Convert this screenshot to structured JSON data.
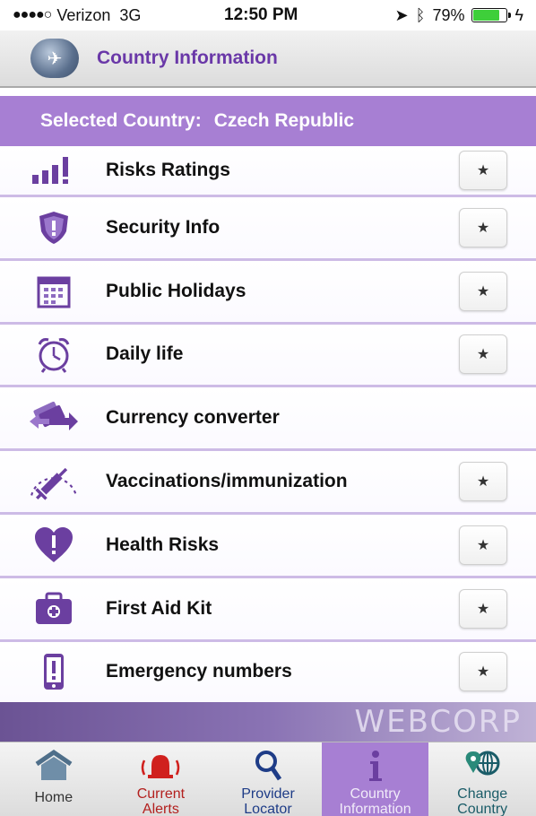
{
  "status": {
    "signal": "●●●●○",
    "carrier": "Verizon",
    "network": "3G",
    "time": "12:50 PM",
    "battery": "79%",
    "battery_level": 0.79
  },
  "header": {
    "title": "Country Information"
  },
  "selected": {
    "label": "Selected Country:",
    "country": "Czech Republic"
  },
  "items": [
    {
      "label": "Risks Ratings",
      "icon": "risk-rating-bars-icon",
      "favorite": true
    },
    {
      "label": "Security Info",
      "icon": "shield-alert-icon",
      "favorite": true
    },
    {
      "label": "Public Holidays",
      "icon": "calendar-icon",
      "favorite": true
    },
    {
      "label": "Daily life",
      "icon": "alarm-clock-icon",
      "favorite": true
    },
    {
      "label": "Currency converter",
      "icon": "currency-exchange-icon",
      "favorite": false
    },
    {
      "label": "Vaccinations/immunization",
      "icon": "syringe-icon",
      "favorite": true
    },
    {
      "label": "Health Risks",
      "icon": "heart-alert-icon",
      "favorite": true
    },
    {
      "label": "First Aid Kit",
      "icon": "first-aid-kit-icon",
      "favorite": true
    },
    {
      "label": "Emergency numbers",
      "icon": "phone-alert-icon",
      "favorite": true
    }
  ],
  "brand": "WEBCORP",
  "tabs": [
    {
      "label_line1": "Home",
      "label_line2": ""
    },
    {
      "label_line1": "Current",
      "label_line2": "Alerts"
    },
    {
      "label_line1": "Provider",
      "label_line2": "Locator"
    },
    {
      "label_line1": "Country",
      "label_line2": "Information"
    },
    {
      "label_line1": "Change",
      "label_line2": "Country"
    }
  ],
  "colors": {
    "accent": "#a77fd3",
    "title": "#6a38a8",
    "icon": "#6b3fa0"
  }
}
